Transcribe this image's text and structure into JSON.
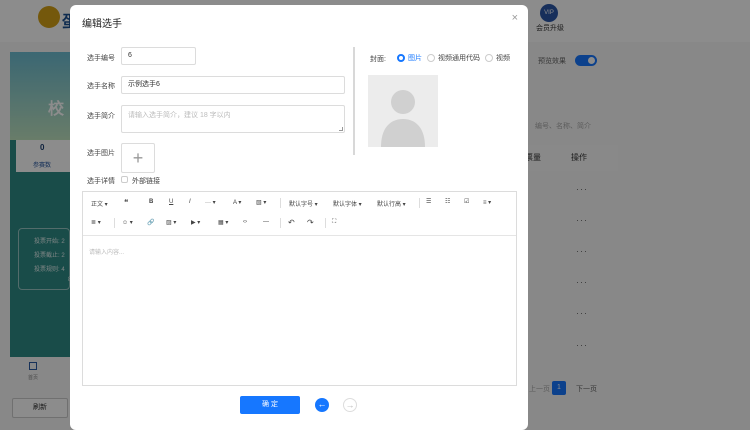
{
  "background": {
    "logo_text": "蛋",
    "vip_badge": "VIP",
    "vip_label": "会员升级",
    "phone_title": "校",
    "stat_value": "0",
    "stat_label": "参赛数",
    "info_lines": [
      "投票开始: 2",
      "投票截止: 2",
      "投票规则: 4",
      "8"
    ],
    "nav_label": "首页",
    "refresh_label": "刷新",
    "preview_label": "预览效果",
    "search_hint": "编号、名称、简介",
    "col_votes": "票量",
    "col_action": "操作",
    "row_action_icon": "···",
    "pagination": {
      "prev": "上一页",
      "current": "1",
      "next": "下一页"
    }
  },
  "modal": {
    "title": "编辑选手",
    "close_icon": "×",
    "fields": {
      "number_label": "选手编号",
      "number_value": "6",
      "name_label": "选手名称",
      "name_value": "示例选手6",
      "intro_label": "选手简介",
      "intro_placeholder": "请输入选手简介，建议 18 字以内",
      "image_label": "选手图片",
      "upload_plus": "+",
      "detail_label": "选手详情",
      "external_link_label": "外部链接"
    },
    "cover": {
      "label": "封面:",
      "options": [
        {
          "label": "图片",
          "selected": true
        },
        {
          "label": "视频通用代码",
          "selected": false
        },
        {
          "label": "视频",
          "selected": false
        }
      ]
    },
    "editor": {
      "toolbar_row1": [
        {
          "label": "正文 ▾",
          "icon": "paragraph-dropdown"
        },
        {
          "label": "❝",
          "icon": "quote-icon"
        },
        {
          "label": "B",
          "icon": "bold-icon"
        },
        {
          "label": "U",
          "icon": "underline-icon"
        },
        {
          "label": "I",
          "icon": "italic-icon"
        },
        {
          "label": "··· ▾",
          "icon": "more-style-icon"
        },
        {
          "label": "A ▾",
          "icon": "font-color-icon"
        },
        {
          "label": "▧ ▾",
          "icon": "bg-color-icon"
        },
        {
          "label": "默认字号 ▾",
          "icon": "font-size-dropdown"
        },
        {
          "label": "默认字体 ▾",
          "icon": "font-family-dropdown"
        },
        {
          "label": "默认行高 ▾",
          "icon": "line-height-dropdown"
        },
        {
          "label": "☰",
          "icon": "bulleted-list-icon"
        },
        {
          "label": "☷",
          "icon": "numbered-list-icon"
        },
        {
          "label": "☑",
          "icon": "todo-icon"
        },
        {
          "label": "≡ ▾",
          "icon": "align-icon"
        }
      ],
      "toolbar_row2": [
        {
          "label": "≣ ▾",
          "icon": "indent-icon"
        },
        {
          "label": "☺ ▾",
          "icon": "emoji-icon"
        },
        {
          "label": "🔗",
          "icon": "link-icon"
        },
        {
          "label": "▨ ▾",
          "icon": "image-icon"
        },
        {
          "label": "▶ ▾",
          "icon": "video-icon"
        },
        {
          "label": "▦ ▾",
          "icon": "table-icon"
        },
        {
          "label": "‹›",
          "icon": "code-icon"
        },
        {
          "label": "—",
          "icon": "divider-icon"
        },
        {
          "label": "↶",
          "icon": "undo-icon"
        },
        {
          "label": "↷",
          "icon": "redo-icon"
        },
        {
          "label": "⛶",
          "icon": "fullscreen-icon"
        }
      ],
      "placeholder": "请输入内容..."
    },
    "confirm_label": "确 定",
    "prev_icon": "←",
    "next_icon": "→",
    "accent_color": "#1677ff"
  }
}
